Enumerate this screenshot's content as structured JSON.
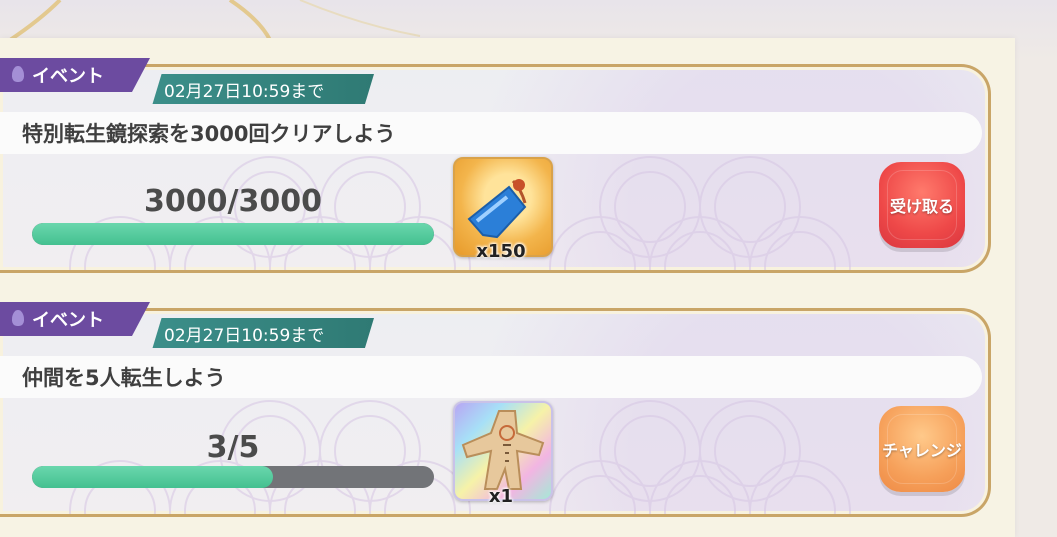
{
  "colors": {
    "event_tag": "#6c4ba0",
    "date_tag": "#3c8f8a",
    "progress_fill": "#44c090",
    "progress_track": "#727478",
    "card_border": "#c9a567",
    "receive_button": "#ee4848",
    "challenge_button": "#f6a05a"
  },
  "missions": [
    {
      "event_label": "イベント",
      "deadline": "02月27日10:59まで",
      "title": "特別転生鏡探索を3000回クリアしよう",
      "progress_text": "3000/3000",
      "progress_fraction": 1.0,
      "reward_icon": "blue-ticket-reward-icon",
      "reward_qty": "x150",
      "button_label": "受け取る"
    },
    {
      "event_label": "イベント",
      "deadline": "02月27日10:59まで",
      "title": "仲間を5人転生しよう",
      "progress_text": "3/5",
      "progress_fraction": 0.6,
      "reward_icon": "paper-doll-reward-icon",
      "reward_qty": "x1",
      "button_label": "チャレンジ"
    }
  ]
}
